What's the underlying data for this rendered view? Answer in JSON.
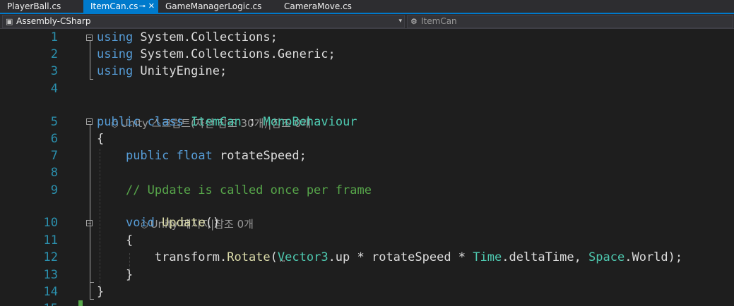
{
  "tabs": [
    {
      "label": "PlayerBall.cs",
      "active": false
    },
    {
      "label": "ItemCan.cs",
      "active": true,
      "pin_icon": "pin-icon",
      "close_icon": "close-icon"
    },
    {
      "label": "GameManagerLogic.cs",
      "active": false
    },
    {
      "label": "CameraMove.cs",
      "active": false
    }
  ],
  "navbar": {
    "project": "Assembly-CSharp",
    "project_icon": "project-icon",
    "type": "ItemCan",
    "type_icon": "class-icon"
  },
  "colors": {
    "keyword": "#569cd6",
    "type": "#4ec9b0",
    "comment": "#57a64a",
    "method": "#dcdcaa",
    "line_number": "#2b91af",
    "accent": "#007acc"
  },
  "code": {
    "lines": [
      {
        "n": "1",
        "tokens": [
          {
            "t": "using",
            "c": "kw"
          },
          {
            "t": " System.Collections;"
          }
        ]
      },
      {
        "n": "2",
        "tokens": [
          {
            "t": "using",
            "c": "kw"
          },
          {
            "t": " System.Collections.Generic;"
          }
        ]
      },
      {
        "n": "3",
        "tokens": [
          {
            "t": "using",
            "c": "kw"
          },
          {
            "t": " UnityEngine;"
          }
        ]
      },
      {
        "n": "4",
        "tokens": []
      },
      {
        "n": "5",
        "tokens": [
          {
            "t": "public",
            "c": "kw"
          },
          {
            "t": " "
          },
          {
            "t": "class",
            "c": "kw"
          },
          {
            "t": " "
          },
          {
            "t": "ItemCan",
            "c": "ty"
          },
          {
            "t": " : "
          },
          {
            "t": "MonoBehaviour",
            "c": "ty"
          }
        ]
      },
      {
        "n": "6",
        "tokens": [
          {
            "t": "{"
          }
        ]
      },
      {
        "n": "7",
        "tokens": [
          {
            "t": "    "
          },
          {
            "t": "public",
            "c": "kw"
          },
          {
            "t": " "
          },
          {
            "t": "float",
            "c": "kw"
          },
          {
            "t": " rotateSpeed;"
          }
        ]
      },
      {
        "n": "8",
        "tokens": []
      },
      {
        "n": "9",
        "tokens": [
          {
            "t": "    "
          },
          {
            "t": "// Update is called once per frame",
            "c": "cm"
          }
        ]
      },
      {
        "n": "10",
        "tokens": [
          {
            "t": "    "
          },
          {
            "t": "void",
            "c": "kw"
          },
          {
            "t": " "
          },
          {
            "t": "Update",
            "c": "fn"
          },
          {
            "t": "()"
          }
        ]
      },
      {
        "n": "11",
        "tokens": [
          {
            "t": "    {"
          }
        ]
      },
      {
        "n": "12",
        "tokens": [
          {
            "t": "        transform."
          },
          {
            "t": "Rotate",
            "c": "fn"
          },
          {
            "t": "("
          },
          {
            "t": "Vector3",
            "c": "ty"
          },
          {
            "t": ".up * rotateSpeed * "
          },
          {
            "t": "Time",
            "c": "ty"
          },
          {
            "t": ".deltaTime, "
          },
          {
            "t": "Space",
            "c": "ty"
          },
          {
            "t": ".World);"
          }
        ]
      },
      {
        "n": "13",
        "tokens": [
          {
            "t": "    }"
          }
        ]
      },
      {
        "n": "14",
        "tokens": [
          {
            "t": "}"
          }
        ]
      },
      {
        "n": "15",
        "tokens": []
      }
    ],
    "lens": [
      {
        "icon": "unity-cube-icon",
        "text": "Unity 스크립트(자산 참조 30개)|참조 0개"
      },
      {
        "icon": "unity-cube-icon",
        "text": "Unity 메시지|참조 0개"
      }
    ],
    "squiggle": "⋯"
  }
}
